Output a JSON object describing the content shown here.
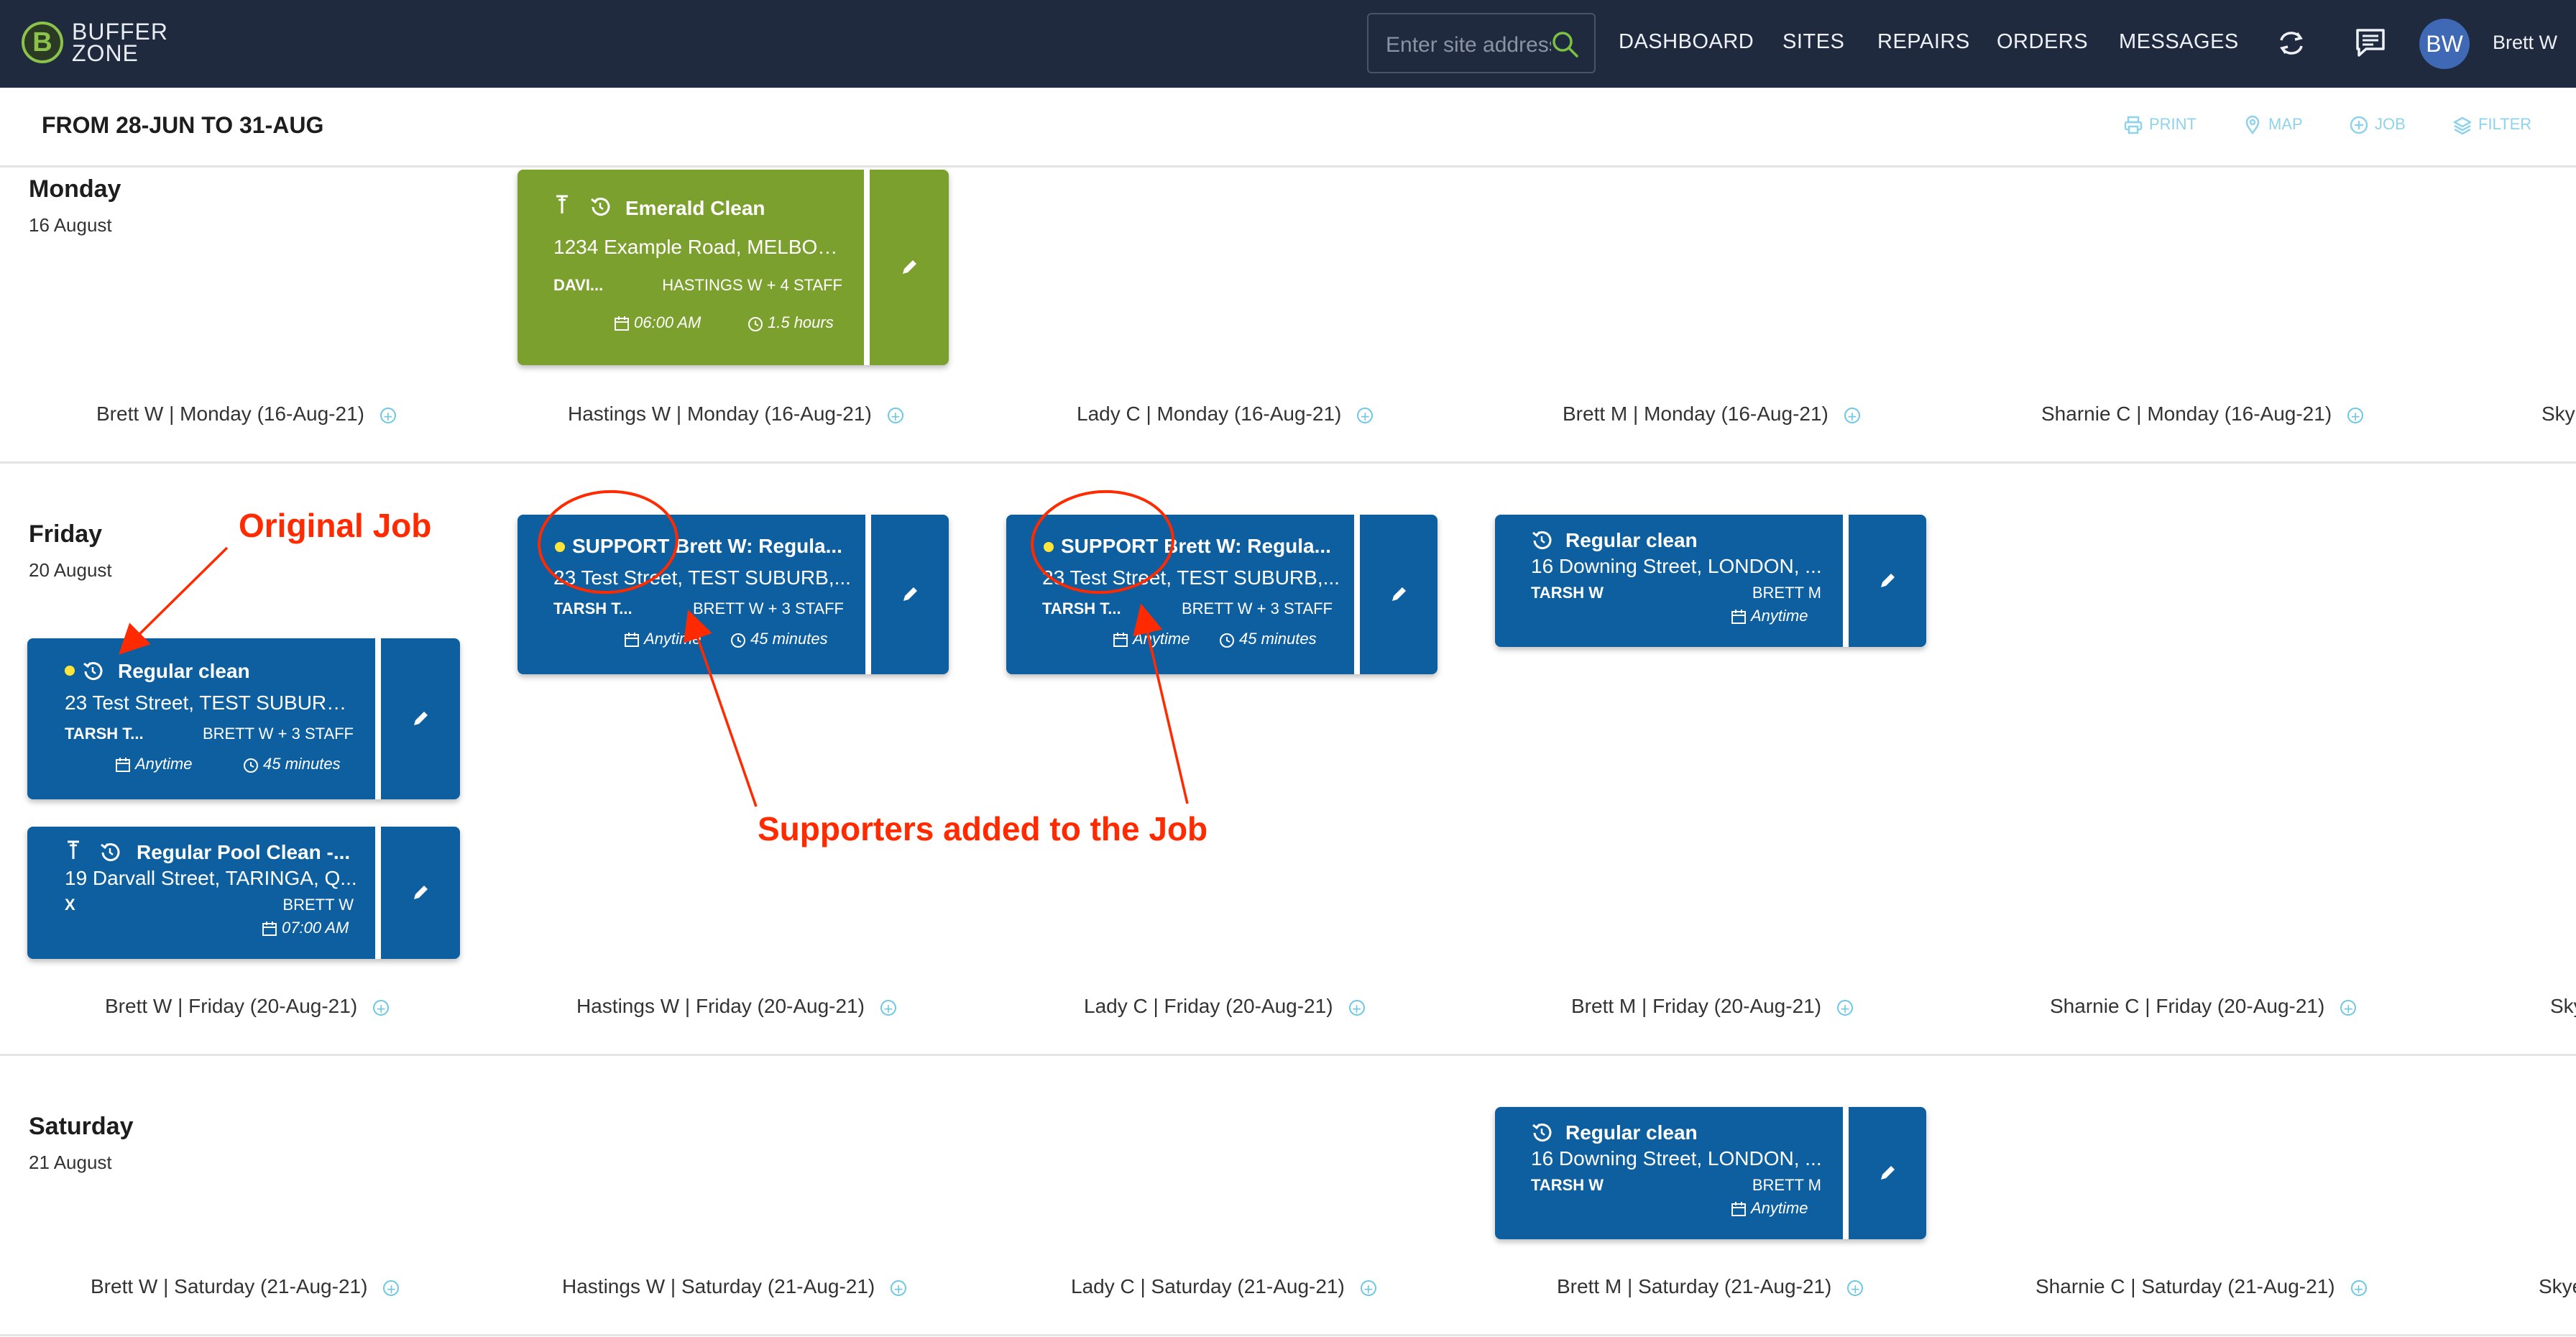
{
  "app": {
    "brand_line1": "BUFFER",
    "brand_line2": "ZONE",
    "logo_letter": "B"
  },
  "search": {
    "placeholder": "Enter site address"
  },
  "nav": {
    "items": [
      "DASHBOARD",
      "SITES",
      "REPAIRS",
      "ORDERS",
      "MESSAGES"
    ],
    "user_initials": "BW",
    "user_name": "Brett W"
  },
  "header": {
    "title": "FROM 28-JUN TO 31-AUG",
    "tools": [
      "PRINT",
      "MAP",
      "JOB",
      "FILTER"
    ]
  },
  "days": [
    {
      "name": "Monday",
      "date": "16 August",
      "staff_labels": [
        "Brett W | Monday (16-Aug-21)",
        "Hastings W | Monday (16-Aug-21)",
        "Lady C | Monday (16-Aug-21)",
        "Brett M | Monday (16-Aug-21)",
        "Sharnie C | Monday (16-Aug-21)",
        "Sky"
      ]
    },
    {
      "name": "Friday",
      "date": "20 August",
      "staff_labels": [
        "Brett W | Friday (20-Aug-21)",
        "Hastings W | Friday (20-Aug-21)",
        "Lady C | Friday (20-Aug-21)",
        "Brett M | Friday (20-Aug-21)",
        "Sharnie C | Friday (20-Aug-21)",
        "Sky"
      ]
    },
    {
      "name": "Saturday",
      "date": "21 August",
      "staff_labels": [
        "Brett W | Saturday (21-Aug-21)",
        "Hastings W | Saturday (21-Aug-21)",
        "Lady C | Saturday (21-Aug-21)",
        "Brett M | Saturday (21-Aug-21)",
        "Sharnie C | Saturday (21-Aug-21)",
        "Skye"
      ]
    }
  ],
  "jobs": {
    "emerald": {
      "title": "Emerald Clean",
      "address": "1234 Example Road, MELBOU...",
      "client": "DAVI...",
      "staff": "HASTINGS W + 4 STAFF",
      "when": "06:00 AM",
      "duration": "1.5 hours"
    },
    "original": {
      "title": "Regular clean",
      "address": "23 Test Street, TEST SUBURB,...",
      "client": "TARSH T...",
      "staff": "BRETT W + 3 STAFF",
      "when": "Anytime",
      "duration": "45 minutes"
    },
    "pool": {
      "title": "Regular Pool Clean -...",
      "address": "19 Darvall Street, TARINGA, Q...",
      "client": "X",
      "staff": "BRETT W",
      "when": "07:00 AM"
    },
    "support1": {
      "title": "SUPPORT Brett W: Regula...",
      "address": "23 Test Street, TEST SUBURB,...",
      "client": "TARSH T...",
      "staff": "BRETT W + 3 STAFF",
      "when": "Anytime",
      "duration": "45 minutes"
    },
    "support2": {
      "title": "SUPPORT Brett W: Regula...",
      "address": "23 Test Street, TEST SUBURB,...",
      "client": "TARSH T...",
      "staff": "BRETT W + 3 STAFF",
      "when": "Anytime",
      "duration": "45 minutes"
    },
    "downing_fri": {
      "title": "Regular clean",
      "address": "16 Downing Street, LONDON, ...",
      "client": "TARSH W",
      "staff": "BRETT M",
      "when": "Anytime"
    },
    "downing_sat": {
      "title": "Regular clean",
      "address": "16 Downing Street, LONDON, ...",
      "client": "TARSH W",
      "staff": "BRETT M",
      "when": "Anytime"
    }
  },
  "annotations": {
    "original_job": "Original Job",
    "supporters": "Supporters added to the Job"
  },
  "colors": {
    "nav_bg": "#1f2a3f",
    "job_blue": "#0d5fa0",
    "job_green": "#7ca02e",
    "accent": "#6cc8e6",
    "annotation": "#ff2a00"
  }
}
